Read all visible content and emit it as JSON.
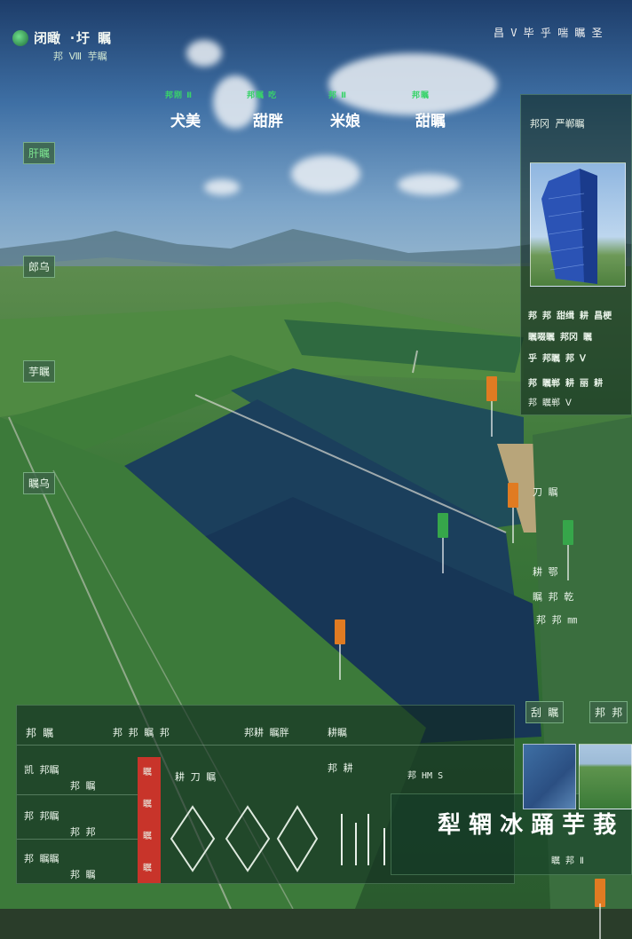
{
  "header": {
    "title": "闭瞰 ·圩 瞩",
    "subtitle": "邦  Ⅷ  芋瞩",
    "right_text": "昌 V 毕  乎 喘 瞩 圣"
  },
  "stats": [
    {
      "label": "邦刚 Ⅱ",
      "value": "犬美"
    },
    {
      "label": "邦瞩 吃",
      "value": "甜胖"
    },
    {
      "label": "邦 Ⅱ",
      "value": "米娘"
    },
    {
      "label": "邦瞩",
      "value": "甜瞩"
    }
  ],
  "left_tags": [
    "肝瞩",
    "郎乌",
    "芋瞩",
    "瞩乌"
  ],
  "right_panel": {
    "title": "邦冈  严郸瞩",
    "lines": [
      "邦 邦 甜缉 耕 昌梗",
      "瞩啜瞩 邦冈 瞩",
      "乎 邦瞩 邦 Ⅴ",
      "邦 瞩郸 耕 丽 耕",
      "邦 瞩郸 Ⅴ"
    ]
  },
  "right_side_lines": [
    "刀 瞩",
    "耕 鄂",
    "瞩 邦 乾",
    "邦 邦 ㎜"
  ],
  "right_bottom_tags": [
    "刮  瞩",
    "邦 邦"
  ],
  "bottom_panel": {
    "header_left": "邦 瞩",
    "header_mid": "邦 邦 瞩 邦",
    "header_right": "邦耕 瞩胖",
    "rows": [
      {
        "a": "凯 邦瞩",
        "b": "邦 瞩"
      },
      {
        "a": "邦 邦瞩",
        "b": "邦 邦"
      },
      {
        "a": "邦 瞩瞩",
        "b": "邦 瞩"
      }
    ],
    "red_labels": [
      "瞩",
      "瞩",
      "瞩",
      "瞩"
    ],
    "mid_labels": [
      "耕瞩",
      "邦 耕",
      "耕 刀 瞩"
    ],
    "status": "邦 HM  S"
  },
  "big_title": "犁 辋 冰 踊 芋 莪",
  "big_subtitle": "瞩 邦 Ⅱ",
  "markers": [
    {
      "color": "#e07b22"
    },
    {
      "color": "#e07b22"
    },
    {
      "color": "#36a64a"
    },
    {
      "color": "#e07b22"
    },
    {
      "color": "#36a64a"
    },
    {
      "color": "#e07b22"
    }
  ]
}
